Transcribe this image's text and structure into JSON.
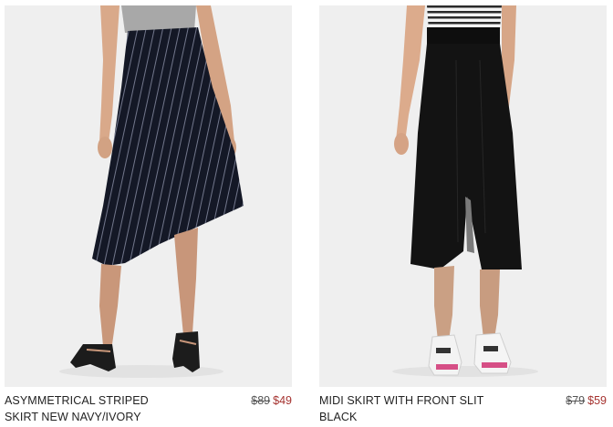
{
  "products": [
    {
      "name": "ASYMMETRICAL STRIPED SKIRT NEW NAVY/IVORY",
      "price_original": "$89",
      "price_sale": "$49"
    },
    {
      "name": "MIDI SKIRT WITH FRONT SLIT BLACK",
      "price_original": "$79",
      "price_sale": "$59"
    }
  ],
  "colors": {
    "image_background": "#efefef",
    "sale_price": "#a5322f",
    "text": "#222222"
  }
}
